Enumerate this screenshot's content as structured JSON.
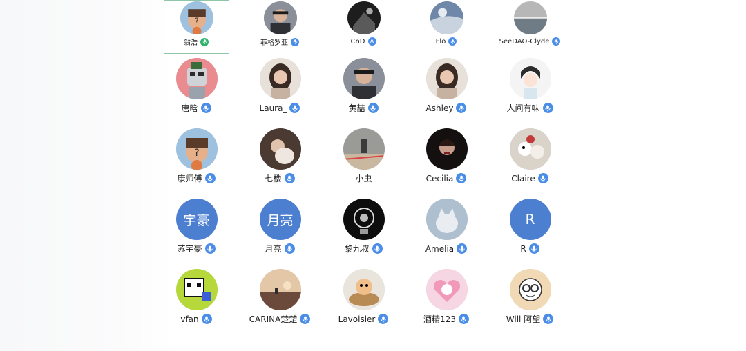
{
  "participants": [
    {
      "name": "翁浩",
      "mic": "green",
      "avatar": "cartoon-question"
    },
    {
      "name": "菲格罗亚",
      "mic": "blue",
      "avatar": "photo-man-glasses"
    },
    {
      "name": "CnD",
      "mic": "blue",
      "avatar": "photo-dark"
    },
    {
      "name": "Flo",
      "mic": "blue",
      "avatar": "photo-sky"
    },
    {
      "name": "SeeDAO-Clyde",
      "mic": "blue",
      "avatar": "photo-sea"
    },
    {
      "name": "唐晗",
      "mic": "blue",
      "avatar": "cartoon-robot"
    },
    {
      "name": "Laura_",
      "mic": "blue",
      "avatar": "photo-woman"
    },
    {
      "name": "黄喆",
      "mic": "blue",
      "avatar": "photo-man-glasses"
    },
    {
      "name": "Ashley",
      "mic": "blue",
      "avatar": "photo-woman"
    },
    {
      "name": "人间有味",
      "mic": "blue",
      "avatar": "cartoon-girl"
    },
    {
      "name": "康师傅",
      "mic": "blue",
      "avatar": "cartoon-question"
    },
    {
      "name": "七楼",
      "mic": "blue",
      "avatar": "photo-woman-cat"
    },
    {
      "name": "小虫",
      "mic": "none",
      "avatar": "photo-street"
    },
    {
      "name": "Cecilia",
      "mic": "blue",
      "avatar": "photo-dark-woman"
    },
    {
      "name": "Claire",
      "mic": "blue",
      "avatar": "photo-toys"
    },
    {
      "name": "苏宇豪",
      "mic": "blue",
      "avatar_text": "宇豪"
    },
    {
      "name": "月亮",
      "mic": "blue",
      "avatar_text": "月亮"
    },
    {
      "name": "黎九叔",
      "mic": "blue",
      "avatar": "logo-dark"
    },
    {
      "name": "Amelia",
      "mic": "blue",
      "avatar": "photo-cat"
    },
    {
      "name": "R",
      "mic": "blue",
      "avatar_text": "R"
    },
    {
      "name": "vfan",
      "mic": "blue",
      "avatar": "cartoon-panda"
    },
    {
      "name": "CARINA楚楚",
      "mic": "blue",
      "avatar": "photo-sunset"
    },
    {
      "name": "Lavoisier",
      "mic": "blue",
      "avatar": "photo-cat-bowl"
    },
    {
      "name": "酒精123",
      "mic": "blue",
      "avatar": "cartoon-heart-cat"
    },
    {
      "name": "Will 阿望",
      "mic": "blue",
      "avatar": "cartoon-glasses"
    }
  ],
  "selected_index": 0,
  "colors": {
    "mic_blue": "#4a8de8",
    "mic_green": "#2fb36a",
    "text_avatar": "#4c7fd0"
  }
}
